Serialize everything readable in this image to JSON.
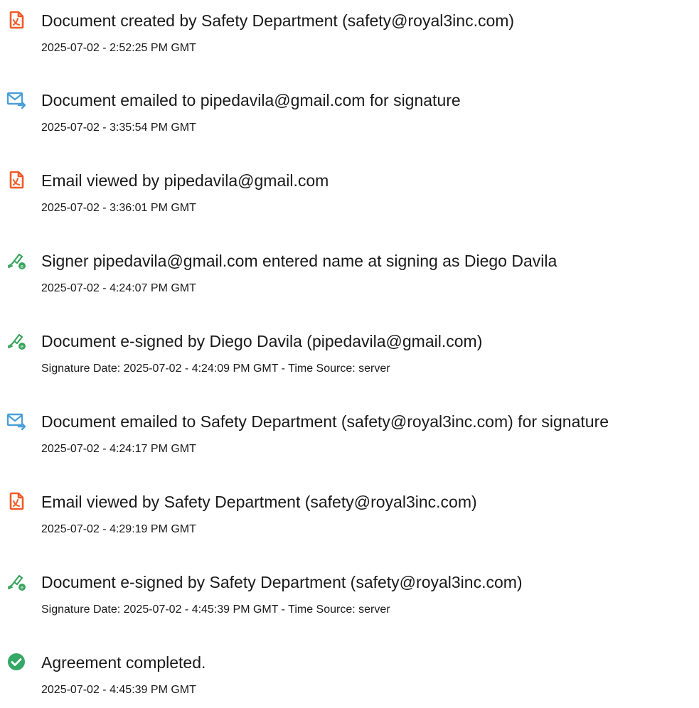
{
  "colors": {
    "doc_icon": "#f05a28",
    "email_icon": "#4a9fd8",
    "sign_icon": "#3aa55d",
    "complete_icon": "#35a865"
  },
  "events": [
    {
      "icon": "document-icon",
      "title": "Document created by Safety Department (safety@royal3inc.com)",
      "meta": "2025-07-02 - 2:52:25 PM GMT"
    },
    {
      "icon": "email-icon",
      "title": "Document emailed to pipedavila@gmail.com for signature",
      "meta": "2025-07-02 - 3:35:54 PM GMT"
    },
    {
      "icon": "document-icon",
      "title": "Email viewed by pipedavila@gmail.com",
      "meta": "2025-07-02 - 3:36:01 PM GMT"
    },
    {
      "icon": "signature-icon",
      "title": "Signer pipedavila@gmail.com entered name at signing as Diego Davila",
      "meta": "2025-07-02 - 4:24:07 PM GMT"
    },
    {
      "icon": "signature-icon",
      "title": "Document e-signed by Diego Davila (pipedavila@gmail.com)",
      "meta": "Signature Date: 2025-07-02 - 4:24:09 PM GMT - Time Source: server"
    },
    {
      "icon": "email-icon",
      "title": "Document emailed to Safety Department (safety@royal3inc.com) for signature",
      "meta": "2025-07-02 - 4:24:17 PM GMT"
    },
    {
      "icon": "document-icon",
      "title": "Email viewed by Safety Department (safety@royal3inc.com)",
      "meta": "2025-07-02 - 4:29:19 PM GMT"
    },
    {
      "icon": "signature-icon",
      "title": "Document e-signed by Safety Department (safety@royal3inc.com)",
      "meta": "Signature Date: 2025-07-02 - 4:45:39 PM GMT - Time Source: server"
    },
    {
      "icon": "check-circle-icon",
      "title": "Agreement completed.",
      "meta": "2025-07-02 - 4:45:39 PM GMT"
    }
  ]
}
